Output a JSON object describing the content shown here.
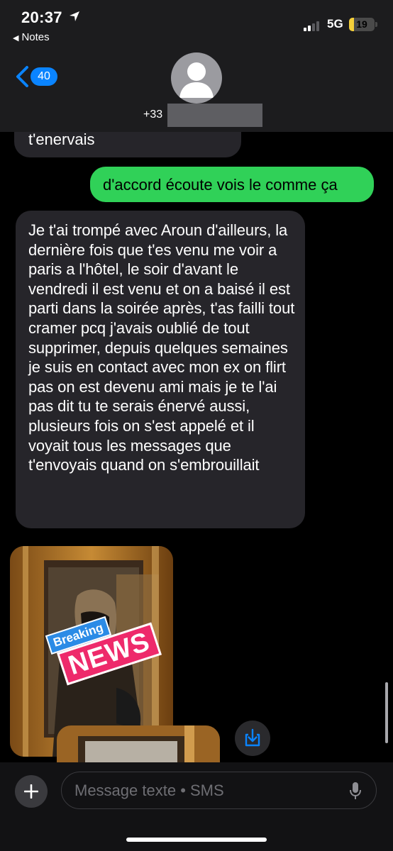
{
  "status_bar": {
    "time": "20:37",
    "back_app": "Notes",
    "network": "5G",
    "battery_level": "19",
    "battery_color": "#f4cf3a"
  },
  "header": {
    "back_count": "40",
    "contact_number": "+33"
  },
  "messages": [
    {
      "direction": "incoming",
      "text": "t'enervais"
    },
    {
      "direction": "outgoing",
      "text": "d'accord écoute vois le comme ça"
    },
    {
      "direction": "incoming",
      "text": "Je t'ai trompé avec Aroun d'ailleurs, la dernière fois que t'es venu me voir a paris a l'hôtel, le soir d'avant le vendredi il est venu et on a baisé il est parti dans la soirée après, t'as failli tout cramer pcq j'avais oublié de tout supprimer, depuis quelques semaines je suis en contact avec mon ex on flirt pas on est devenu ami mais je te l'ai pas dit tu te serais énervé aussi, plusieurs fois on s'est appelé et il voyait tous les messages que t'envoyais quand on s'embrouillait"
    }
  ],
  "sticker": {
    "line1": "Breaking",
    "line2": "NEWS"
  },
  "composer": {
    "placeholder": "Message texte • SMS"
  },
  "colors": {
    "outgoing_bubble": "#30d158",
    "incoming_bubble": "#26252a",
    "accent": "#0a84ff"
  }
}
